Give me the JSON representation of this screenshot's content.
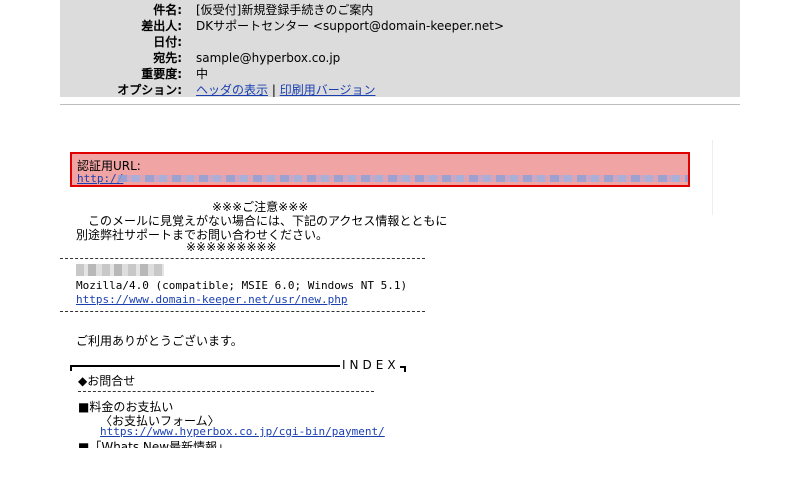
{
  "header": {
    "subject_label": "件名:",
    "subject_value": "[仮受付]新規登録手続きのご案内",
    "from_label": "差出人:",
    "from_value": "DKサポートセンター <support@domain-keeper.net>",
    "date_label": "日付:",
    "date_value": "",
    "to_label": "宛先:",
    "to_value": "sample@hyperbox.co.jp",
    "priority_label": "重要度:",
    "priority_value": "中",
    "options_label": "オプション:",
    "option_show_header": "ヘッダの表示",
    "option_separator": "|",
    "option_print_version": "印刷用バージョン"
  },
  "body": {
    "auth_url_label": "認証用URL:",
    "auth_url_prefix": "http://",
    "notice_title": "※※※ご注意※※※",
    "notice_line1": "このメールに見覚えがない場合には、下記のアクセス情報とともに",
    "notice_line2": "別途弊社サポートまでお問い合わせください。",
    "notice_stars": "※※※※※※※※※",
    "user_agent": "Mozilla/4.0 (compatible; MSIE 6.0; Windows NT 5.1)",
    "referrer_url": "https://www.domain-keeper.net/usr/new.php",
    "thanks": "ご利用ありがとうございます。",
    "index_title": "INDEX",
    "index_items": [
      "◆お問合せ",
      "■料金のお支払い",
      "〈お支払いフォーム〉",
      "https://www.hyperbox.co.jp/cgi-bin/payment/",
      "■「Whats New最新情報」"
    ]
  }
}
